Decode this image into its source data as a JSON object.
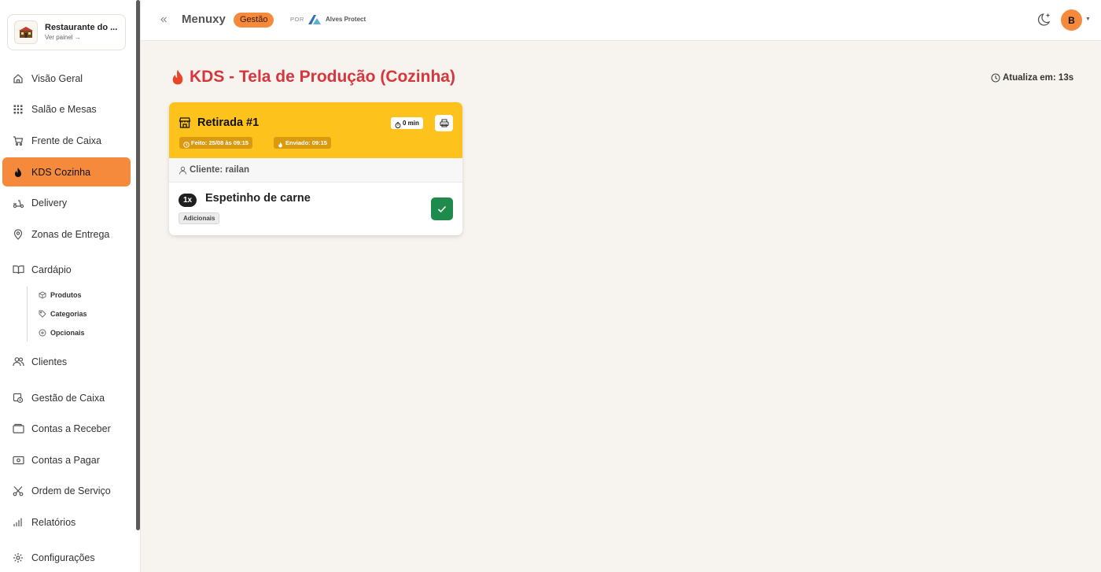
{
  "brand": {
    "name": "Restaurante do ...",
    "sub": "Ver painel →"
  },
  "sidebar": {
    "items": [
      {
        "label": "Visão Geral",
        "icon": "home-icon"
      },
      {
        "label": "Salão e Mesas",
        "icon": "grid-icon"
      },
      {
        "label": "Frente de Caixa",
        "icon": "cart-icon"
      },
      {
        "label": "KDS Cozinha",
        "icon": "flame-icon",
        "active": true
      },
      {
        "label": "Delivery",
        "icon": "scooter-icon"
      },
      {
        "label": "Zonas de Entrega",
        "icon": "map-pin-icon"
      },
      {
        "label": "Cardápio",
        "icon": "book-icon"
      },
      {
        "label": "Clientes",
        "icon": "users-icon"
      },
      {
        "label": "Gestão de Caixa",
        "icon": "cash-register-icon"
      },
      {
        "label": "Contas a Receber",
        "icon": "wallet-icon"
      },
      {
        "label": "Contas a Pagar",
        "icon": "banknote-icon"
      },
      {
        "label": "Ordem de Serviço",
        "icon": "scissors-icon"
      },
      {
        "label": "Relatórios",
        "icon": "bar-chart-icon"
      },
      {
        "label": "Configurações",
        "icon": "gear-icon"
      }
    ],
    "subitems": [
      {
        "label": "Produtos",
        "icon": "package-icon"
      },
      {
        "label": "Categorias",
        "icon": "tag-icon"
      },
      {
        "label": "Opcionais",
        "icon": "plus-circle-icon"
      }
    ]
  },
  "topbar": {
    "app_name": "Menuxy",
    "badge": "Gestão",
    "por": "POR",
    "partner": "Alves Protect",
    "avatar_initial": "B"
  },
  "main": {
    "title": "KDS - Tela de Produção (Cozinha)",
    "refresh": "Atualiza em: 13s"
  },
  "order": {
    "title": "Retirada #1",
    "timer": "0 min",
    "made": "Feito: 25/08 às 09:15",
    "sent": "Enviado: 09:15",
    "client": "Cliente: railan",
    "items": [
      {
        "qty": "1x",
        "name": "Espetinho de carne",
        "addon_label": "Adicionais"
      }
    ]
  },
  "colors": {
    "accent": "#f58a3d",
    "title_red": "#d8363c",
    "card_header": "#fdc21b",
    "confirm_green": "#1e8a4c"
  }
}
